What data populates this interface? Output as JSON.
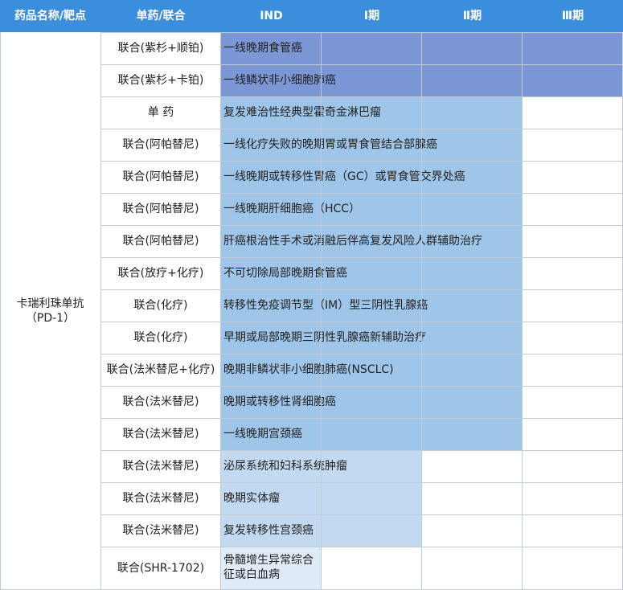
{
  "header": {
    "drug_col": "药品名称/靶点",
    "mode_col": "单药/联合",
    "ind_col": "IND",
    "p1_col": "Ⅰ期",
    "p2_col": "Ⅱ期",
    "p3_col": "Ⅲ期"
  },
  "drug": {
    "name": "卡瑞利珠单抗",
    "target": "（PD-1）"
  },
  "colors": {
    "header": "#3b8edb",
    "phase3": "#7b97d6",
    "phase2": "#9fc5e8",
    "phase1": "#c2d9f0",
    "ind": "#dfebf7",
    "grid": "#bfcbd8"
  },
  "rows": [
    {
      "mode": "联合(紫杉+顺铂)",
      "indication": "一线晚期食管癌",
      "phase": "Ⅲ"
    },
    {
      "mode": "联合(紫杉+卡铂)",
      "indication": "一线鳞状非小细胞肺癌",
      "phase": "Ⅲ"
    },
    {
      "mode": "单 药",
      "indication": "复发难治性经典型霍奇金淋巴瘤",
      "phase": "Ⅱ"
    },
    {
      "mode": "联合(阿帕替尼)",
      "indication": "一线化疗失败的晚期胃或胃食管结合部腺癌",
      "phase": "Ⅱ"
    },
    {
      "mode": "联合(阿帕替尼)",
      "indication": "一线晚期或转移性胃癌（GC）或胃食管交界处癌",
      "phase": "Ⅱ"
    },
    {
      "mode": "联合(阿帕替尼)",
      "indication": "一线晚期肝细胞癌（HCC）",
      "phase": "Ⅱ"
    },
    {
      "mode": "联合(阿帕替尼)",
      "indication": "肝癌根治性手术或消融后伴高复发风险人群辅助治疗",
      "phase": "Ⅱ"
    },
    {
      "mode": "联合(放疗+化疗)",
      "indication": "不可切除局部晚期食管癌",
      "phase": "Ⅱ"
    },
    {
      "mode": "联合(化疗)",
      "indication": "转移性免疫调节型（IM）型三阴性乳腺癌",
      "phase": "Ⅱ"
    },
    {
      "mode": "联合(化疗)",
      "indication": "早期或局部晚期三阴性乳腺癌新辅助治疗",
      "phase": "Ⅱ"
    },
    {
      "mode": "联合(法米替尼+化疗)",
      "indication": "晚期非鳞状非小细胞肺癌(NSCLC)",
      "phase": "Ⅱ"
    },
    {
      "mode": "联合(法米替尼)",
      "indication": "晚期或转移性肾细胞癌",
      "phase": "Ⅱ"
    },
    {
      "mode": "联合(法米替尼)",
      "indication": "一线晚期宫颈癌",
      "phase": "Ⅱ"
    },
    {
      "mode": "联合(法米替尼)",
      "indication": "泌尿系统和妇科系统肿瘤",
      "phase": "Ⅰ"
    },
    {
      "mode": "联合(法米替尼)",
      "indication": "晚期实体瘤",
      "phase": "Ⅰ"
    },
    {
      "mode": "联合(法米替尼)",
      "indication": "复发转移性宫颈癌",
      "phase": "Ⅰ"
    },
    {
      "mode": "联合(SHR-1702)",
      "indication": "骨髓增生异常综合征或白血病",
      "phase": "IND"
    }
  ]
}
